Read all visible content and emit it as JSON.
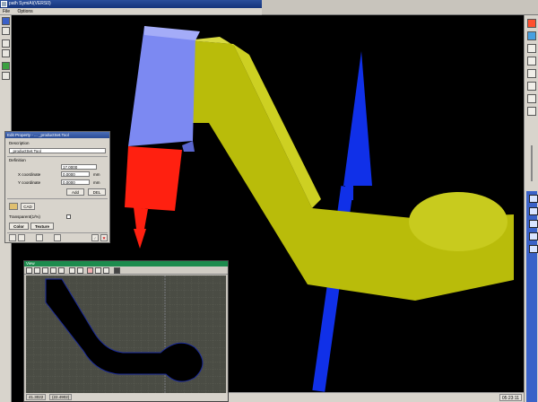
{
  "window": {
    "title": "path SymiAI(VERS0)"
  },
  "menu": {
    "items": [
      "File",
      "Options"
    ]
  },
  "dialog": {
    "title": "Edit Property - ... _productSet.Tool",
    "description_label": "Description",
    "description_value": "_productSet.Tool",
    "definition_label": "Definition",
    "def_value": "17.0000",
    "x_label": "X coordinate",
    "x_value": "0.0000",
    "x_unit": "mm",
    "y_label": "Y coordinate",
    "y_value": "0.0000",
    "y_unit": "mm",
    "add_label": "Add",
    "del_label": "DEL",
    "cad_label": "CAD",
    "transparent_label": "Transparent(1/%)",
    "color_tab": "Color",
    "texture_tab": "Texture"
  },
  "view2d": {
    "title": "View",
    "coord_x": "41.3022",
    "coord_y": "(22.4902)"
  },
  "status": {
    "clock": "05:23:11"
  },
  "colors": {
    "cutter_body": "#ff2010",
    "cutter_holder": "#7c89f2",
    "part_arm": "#b9bc0a",
    "axis_arrow": "#1030e8",
    "window_title": "#2a4f9c",
    "view_title": "#1d8c4e"
  }
}
